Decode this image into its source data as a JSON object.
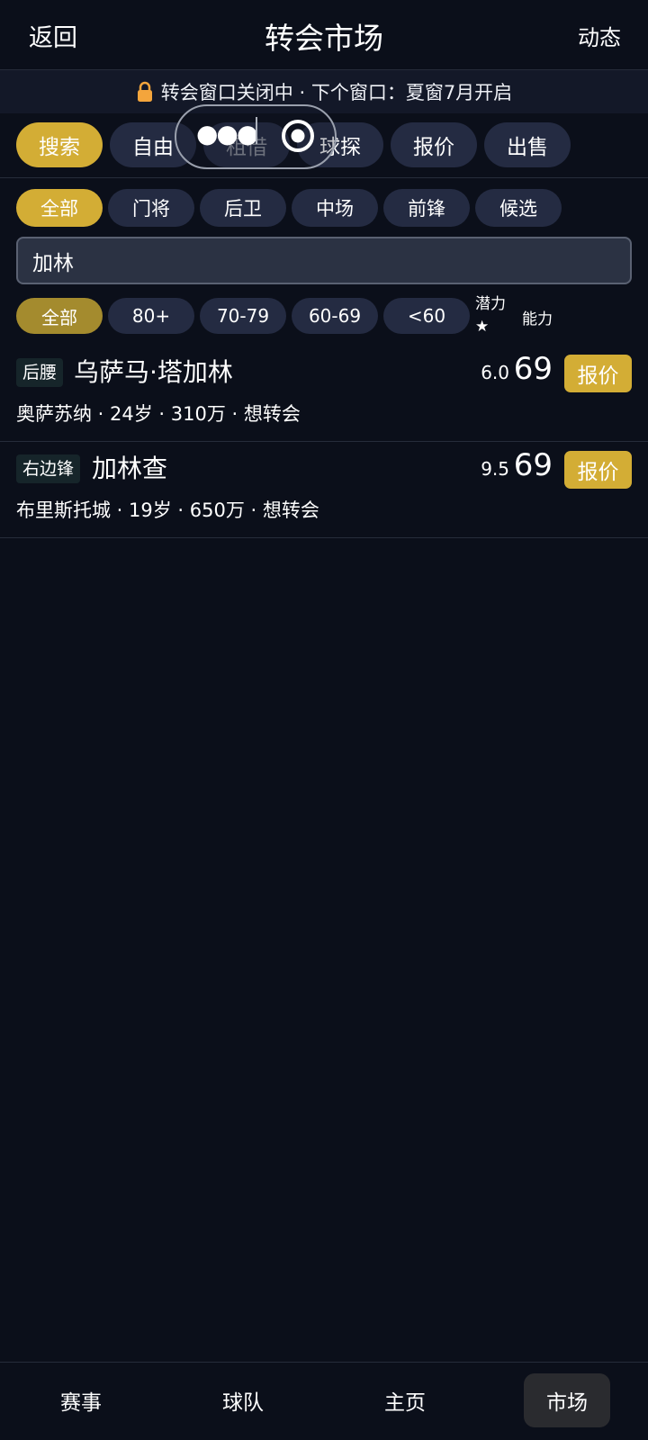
{
  "header": {
    "back_label": "返回",
    "title": "转会市场",
    "feed_label": "动态"
  },
  "notice": {
    "icon": "lock-icon",
    "text": "转会窗口关闭中 · 下个窗口：夏窗7月开启"
  },
  "mode_tabs": [
    {
      "label": "搜索",
      "active": true
    },
    {
      "label": "自由"
    },
    {
      "label": "租借"
    },
    {
      "label": "球探"
    },
    {
      "label": "报价"
    },
    {
      "label": "出售"
    }
  ],
  "position_filter": [
    {
      "label": "全部",
      "active": true
    },
    {
      "label": "门将"
    },
    {
      "label": "后卫"
    },
    {
      "label": "中场"
    },
    {
      "label": "前锋"
    },
    {
      "label": "候选"
    }
  ],
  "search": {
    "value": "加林"
  },
  "rating_filter": [
    {
      "label": "全部",
      "active": true
    },
    {
      "label": "80+"
    },
    {
      "label": "70-79"
    },
    {
      "label": "60-69"
    },
    {
      "label": "<60"
    }
  ],
  "sort": {
    "potential_label": "潜力★",
    "ability_label": "能力"
  },
  "players": [
    {
      "position": "后腰",
      "name": "乌萨马·塔加林",
      "potential": "6.0",
      "ability": "69",
      "meta": "奥萨苏纳 · 24岁 · 310万 · 想转会",
      "offer_label": "报价"
    },
    {
      "position": "右边锋",
      "name": "加林查",
      "potential": "9.5",
      "ability": "69",
      "meta": "布里斯托城 · 19岁 · 650万 · 想转会",
      "offer_label": "报价"
    }
  ],
  "bottom_nav": [
    {
      "label": "赛事"
    },
    {
      "label": "球队"
    },
    {
      "label": "主页"
    },
    {
      "label": "市场",
      "active": true
    }
  ],
  "colors": {
    "background": "#0b0f1a",
    "accent": "#d3ad35",
    "pill": "#242b42"
  }
}
